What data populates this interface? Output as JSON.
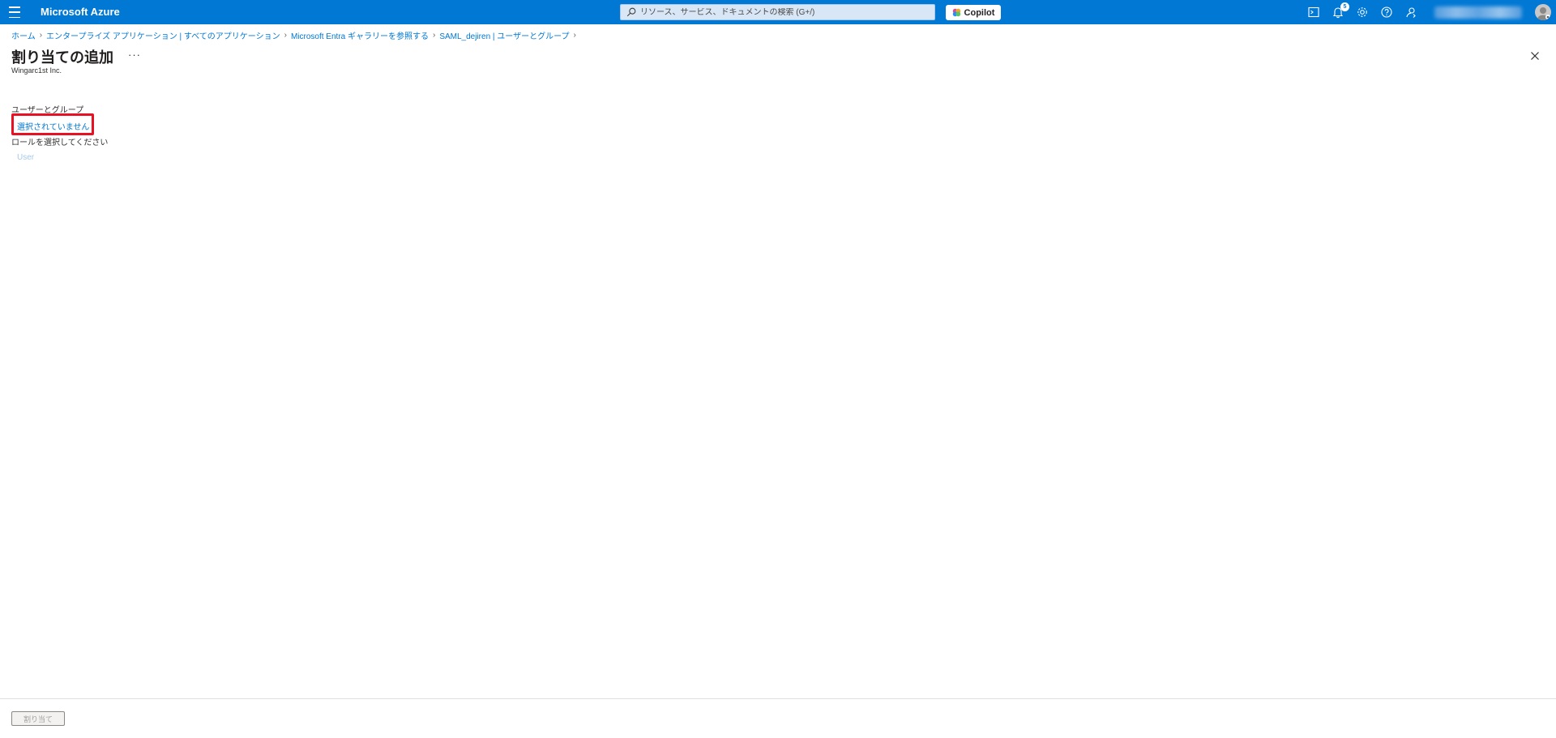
{
  "header": {
    "brand": "Microsoft Azure",
    "search_placeholder": "リソース、サービス、ドキュメントの検索 (G+/)",
    "copilot_label": "Copilot",
    "notifications_count": "5",
    "accent_color": "#0078d4"
  },
  "breadcrumb": [
    "ホーム",
    "エンタープライズ アプリケーション | すべてのアプリケーション",
    "Microsoft Entra ギャラリーを参照する",
    "SAML_dejiren | ユーザーとグループ"
  ],
  "page": {
    "title": "割り当ての追加",
    "more_label": "···",
    "subtitle": "Wingarc1st Inc."
  },
  "form": {
    "users_groups_label": "ユーザーとグループ",
    "users_groups_value": "選択されていません",
    "role_label": "ロールを選択してください",
    "role_value": "User"
  },
  "footer": {
    "assign_label": "割り当て"
  }
}
